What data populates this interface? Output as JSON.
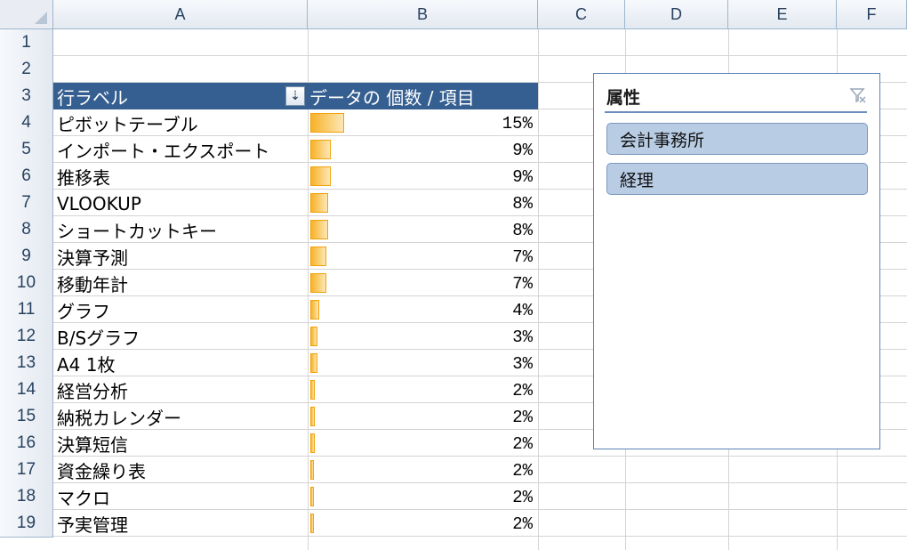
{
  "columns": [
    "A",
    "B",
    "C",
    "D",
    "E",
    "F"
  ],
  "row_numbers": [
    "1",
    "2",
    "3",
    "4",
    "5",
    "6",
    "7",
    "8",
    "9",
    "10",
    "11",
    "12",
    "13",
    "14",
    "15",
    "16",
    "17",
    "18",
    "19"
  ],
  "pivot": {
    "row_label_header": "行ラベル",
    "value_header": "データの 個数 / 項目",
    "filter_icon": "sort-filter-icon",
    "bar_color": "#f7b228",
    "header_color": "#365f91",
    "rows": [
      {
        "label": "ピボットテーブル",
        "value": "15%",
        "fraction": 0.15
      },
      {
        "label": "インポート・エクスポート",
        "value": "9%",
        "fraction": 0.09
      },
      {
        "label": "推移表",
        "value": "9%",
        "fraction": 0.09
      },
      {
        "label": "VLOOKUP",
        "value": "8%",
        "fraction": 0.08
      },
      {
        "label": "ショートカットキー",
        "value": "8%",
        "fraction": 0.08
      },
      {
        "label": "決算予測",
        "value": "7%",
        "fraction": 0.07
      },
      {
        "label": "移動年計",
        "value": "7%",
        "fraction": 0.07
      },
      {
        "label": "グラフ",
        "value": "4%",
        "fraction": 0.04
      },
      {
        "label": "B/Sグラフ",
        "value": "3%",
        "fraction": 0.03
      },
      {
        "label": "A4 1枚",
        "value": "3%",
        "fraction": 0.03
      },
      {
        "label": "経営分析",
        "value": "2%",
        "fraction": 0.02
      },
      {
        "label": "納税カレンダー",
        "value": "2%",
        "fraction": 0.02
      },
      {
        "label": "決算短信",
        "value": "2%",
        "fraction": 0.02
      },
      {
        "label": "資金繰り表",
        "value": "2%",
        "fraction": 0.015
      },
      {
        "label": "マクロ",
        "value": "2%",
        "fraction": 0.015
      },
      {
        "label": "予実管理",
        "value": "2%",
        "fraction": 0.015
      }
    ]
  },
  "slicer": {
    "title": "属性",
    "clear_icon": "clear-filter-icon",
    "items": [
      "会計事務所",
      "経理"
    ],
    "item_color": "#b8cce4"
  }
}
